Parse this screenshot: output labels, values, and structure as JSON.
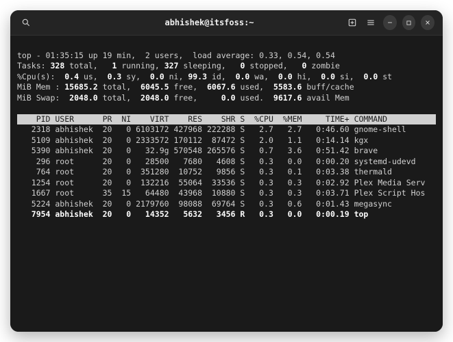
{
  "title": "abhishek@itsfoss:~",
  "summary": {
    "line1": "top - 01:35:15 up 19 min,  2 users,  load average: 0.33, 0.54, 0.54",
    "tasks": {
      "total": "328",
      "running": "1",
      "sleeping": "327",
      "stopped": "0",
      "zombie": "0"
    },
    "cpu": {
      "us": "0.4",
      "sy": "0.3",
      "ni": "0.0",
      "id": "99.3",
      "wa": "0.0",
      "hi": "0.0",
      "si": "0.0",
      "st": "0.0"
    },
    "mem": {
      "total": "15685.2",
      "free": "6045.5",
      "used": "6067.6",
      "buff": "5583.6"
    },
    "swap": {
      "total": "2048.0",
      "free": "2048.0",
      "used": "0.0",
      "avail": "9617.6"
    }
  },
  "cols": "    PID USER      PR  NI    VIRT    RES    SHR S  %CPU  %MEM     TIME+ COMMAND         ",
  "procs": [
    {
      "pid": "2318",
      "user": "abhishek",
      "pr": "20",
      "ni": "0",
      "virt": "6103172",
      "res": "427968",
      "shr": "222288",
      "s": "S",
      "cpu": "2.7",
      "mem": "2.7",
      "time": "0:46.60",
      "cmd": "gnome-shell"
    },
    {
      "pid": "5109",
      "user": "abhishek",
      "pr": "20",
      "ni": "0",
      "virt": "2333572",
      "res": "170112",
      "shr": "87472",
      "s": "S",
      "cpu": "2.0",
      "mem": "1.1",
      "time": "0:14.14",
      "cmd": "kgx"
    },
    {
      "pid": "5390",
      "user": "abhishek",
      "pr": "20",
      "ni": "0",
      "virt": "32.9g",
      "res": "570548",
      "shr": "265576",
      "s": "S",
      "cpu": "0.7",
      "mem": "3.6",
      "time": "0:51.42",
      "cmd": "brave"
    },
    {
      "pid": "296",
      "user": "root",
      "pr": "20",
      "ni": "0",
      "virt": "28500",
      "res": "7680",
      "shr": "4608",
      "s": "S",
      "cpu": "0.3",
      "mem": "0.0",
      "time": "0:00.20",
      "cmd": "systemd-udevd"
    },
    {
      "pid": "764",
      "user": "root",
      "pr": "20",
      "ni": "0",
      "virt": "351280",
      "res": "10752",
      "shr": "9856",
      "s": "S",
      "cpu": "0.3",
      "mem": "0.1",
      "time": "0:03.38",
      "cmd": "thermald"
    },
    {
      "pid": "1254",
      "user": "root",
      "pr": "20",
      "ni": "0",
      "virt": "132216",
      "res": "55064",
      "shr": "33536",
      "s": "S",
      "cpu": "0.3",
      "mem": "0.3",
      "time": "0:02.92",
      "cmd": "Plex Media Serv"
    },
    {
      "pid": "1667",
      "user": "root",
      "pr": "35",
      "ni": "15",
      "virt": "64480",
      "res": "43968",
      "shr": "10880",
      "s": "S",
      "cpu": "0.3",
      "mem": "0.3",
      "time": "0:03.71",
      "cmd": "Plex Script Hos"
    },
    {
      "pid": "5224",
      "user": "abhishek",
      "pr": "20",
      "ni": "0",
      "virt": "2179760",
      "res": "98088",
      "shr": "69764",
      "s": "S",
      "cpu": "0.3",
      "mem": "0.6",
      "time": "0:01.43",
      "cmd": "megasync"
    },
    {
      "pid": "7954",
      "user": "abhishek",
      "pr": "20",
      "ni": "0",
      "virt": "14352",
      "res": "5632",
      "shr": "3456",
      "s": "R",
      "cpu": "0.3",
      "mem": "0.0",
      "time": "0:00.19",
      "cmd": "top",
      "bold": true
    }
  ]
}
